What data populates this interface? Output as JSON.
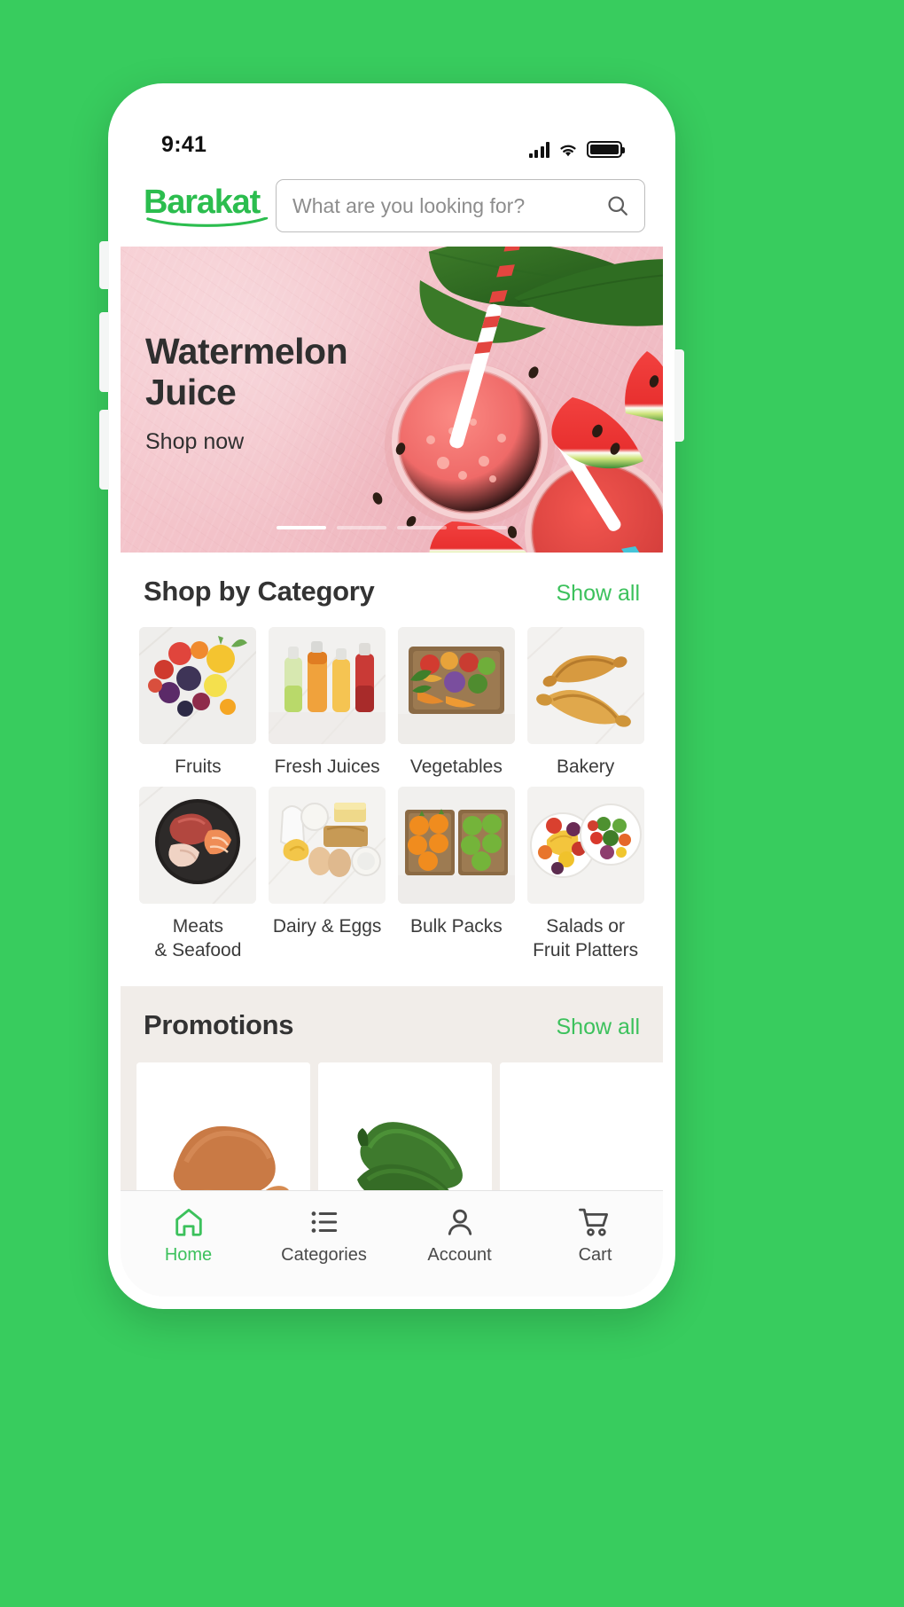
{
  "theme": {
    "page_background": "#38cc5e",
    "brand_green": "#2bbd4e",
    "accent_green": "#3cc15c",
    "banner_pink": "#f2c0c7",
    "promotions_background": "#f1ede9",
    "text_dark": "#333333"
  },
  "status_bar": {
    "time": "9:41",
    "cellular_icon": "signal-bars-icon",
    "wifi_icon": "wifi-icon",
    "battery_icon": "battery-full-icon"
  },
  "header": {
    "logo_text": "Barakat",
    "logo_icon": "barakat-wordmark-logo",
    "search": {
      "placeholder": "What are you looking for?",
      "value": "",
      "icon": "search-icon"
    }
  },
  "hero_banner": {
    "title": "Watermelon\nJuice",
    "cta_label": "Shop now",
    "image_alt": "watermelon-juice-photo",
    "carousel": {
      "total": 4,
      "active_index": 0
    }
  },
  "categories_section": {
    "title": "Shop by Category",
    "show_all_label": "Show all",
    "items": [
      {
        "label": "Fruits",
        "thumb": "fruits-thumb"
      },
      {
        "label": "Fresh Juices",
        "thumb": "fresh-juices-thumb"
      },
      {
        "label": "Vegetables",
        "thumb": "vegetables-thumb"
      },
      {
        "label": "Bakery",
        "thumb": "bakery-thumb"
      },
      {
        "label": "Meats\n& Seafood",
        "thumb": "meats-seafood-thumb"
      },
      {
        "label": "Dairy & Eggs",
        "thumb": "dairy-eggs-thumb"
      },
      {
        "label": "Bulk Packs",
        "thumb": "bulk-packs-thumb"
      },
      {
        "label": "Salads or\nFruit Platters",
        "thumb": "salads-fruit-platters-thumb"
      }
    ]
  },
  "promotions_section": {
    "title": "Promotions",
    "show_all_label": "Show all",
    "cards": [
      {
        "image_alt": "sweet-potato-photo"
      },
      {
        "image_alt": "zucchini-photo"
      },
      {
        "image_alt": "next-promo-photo"
      }
    ]
  },
  "bottom_nav": {
    "active_index": 0,
    "items": [
      {
        "label": "Home",
        "icon": "home-icon"
      },
      {
        "label": "Categories",
        "icon": "list-icon"
      },
      {
        "label": "Account",
        "icon": "person-icon"
      },
      {
        "label": "Cart",
        "icon": "cart-icon"
      }
    ]
  }
}
